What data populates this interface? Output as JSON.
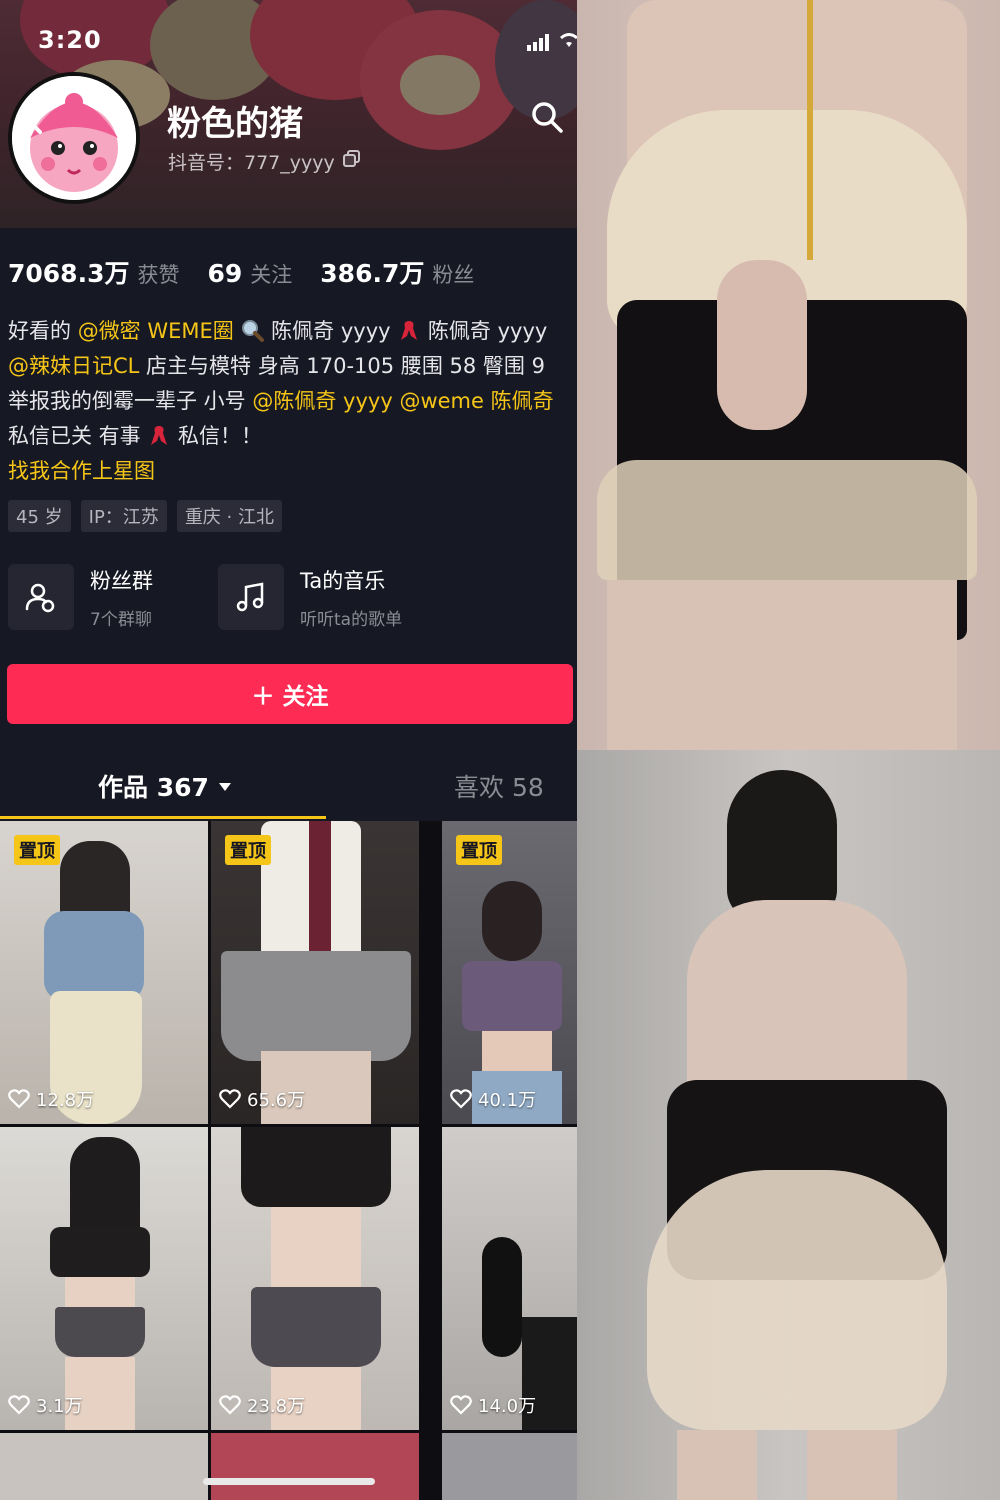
{
  "status_bar": {
    "time": "3:20"
  },
  "profile": {
    "display_name": "粉色的猪",
    "douyin_id": "抖音号：777_yyyy"
  },
  "stats": [
    {
      "value": "7068.3万",
      "label": "获赞"
    },
    {
      "value": "69",
      "label": "关注"
    },
    {
      "value": "386.7万",
      "label": "粉丝"
    }
  ],
  "bio": {
    "line1": {
      "t1": "好看的 ",
      "m1": "@微密 WEME圈",
      "t2": " 陈佩奇 yyyy ",
      "t3": " 陈佩奇 yyyy"
    },
    "line2": {
      "m1": "@辣妹日记CL",
      "t1": " 店主与模特 身高 170-105 腰围 58 臀围 9"
    },
    "line3": {
      "t1": "举报我的倒霉一辈子 小号 ",
      "m1": "@陈佩奇 yyyy",
      "t2": " ",
      "m2": "@weme 陈佩奇"
    },
    "line4": {
      "t1": "私信已关 有事 ",
      "t2": " 私信！！"
    },
    "line5": "找我合作上星图"
  },
  "tags": [
    "45 岁",
    "IP：江苏",
    "重庆 · 江北"
  ],
  "features": [
    {
      "title": "粉丝群",
      "subtitle": "7个群聊",
      "icon": "users-icon"
    },
    {
      "title": "Ta的音乐",
      "subtitle": "听听ta的歌单",
      "icon": "music-note-icon"
    }
  ],
  "follow_button": "＋ 关注",
  "tabs": {
    "works": "作品 367",
    "likes": "喜欢 58"
  },
  "pin_label": "置顶",
  "videos": [
    {
      "likes": "12.8万",
      "pinned": true
    },
    {
      "likes": "65.6万",
      "pinned": true
    },
    {
      "likes": "40.1万",
      "pinned": true
    },
    {
      "likes": "3.1万",
      "pinned": false
    },
    {
      "likes": "23.8万",
      "pinned": false
    },
    {
      "likes": "14.0万",
      "pinned": false
    }
  ],
  "colors": {
    "accent_red": "#fe2c55",
    "accent_gold": "#f5c518",
    "background": "#161823"
  }
}
